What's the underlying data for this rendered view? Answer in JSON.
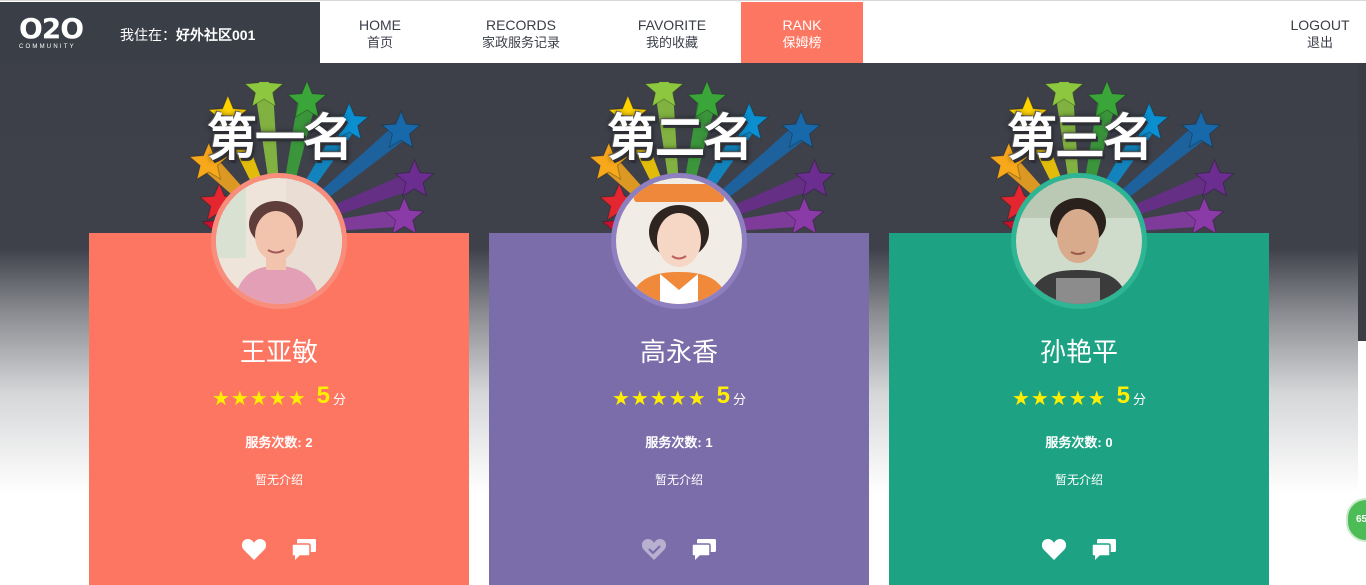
{
  "header": {
    "logo_main": "O2O",
    "logo_sub": "COMMUNITY",
    "location_label": "我住在：",
    "location_value": "好外社区001"
  },
  "nav": {
    "home": {
      "en": "HOME",
      "cn": "首页"
    },
    "records": {
      "en": "RECORDS",
      "cn": "家政服务记录"
    },
    "favorite": {
      "en": "FAVORITE",
      "cn": "我的收藏"
    },
    "rank": {
      "en": "RANK",
      "cn": "保姆榜",
      "active": true
    },
    "logout": {
      "en": "LOGOUT",
      "cn": "退出"
    }
  },
  "colors": {
    "accent": "#fd7662",
    "card1": "#fd7662",
    "card2": "#7a6da9",
    "card3": "#1da384",
    "star": "#ffee00",
    "header_dark": "#3a3e47"
  },
  "cards": [
    {
      "rank_title": "第一名",
      "name": "王亚敏",
      "stars": "★★★★★",
      "score": "5",
      "score_unit": "分",
      "service_label": "服务次数: ",
      "service_count": "2",
      "intro": "暂无介绍",
      "favorited": false
    },
    {
      "rank_title": "第二名",
      "name": "高永香",
      "stars": "★★★★★",
      "score": "5",
      "score_unit": "分",
      "service_label": "服务次数: ",
      "service_count": "1",
      "intro": "暂无介绍",
      "favorited": true
    },
    {
      "rank_title": "第三名",
      "name": "孙艳平",
      "stars": "★★★★★",
      "score": "5",
      "score_unit": "分",
      "service_label": "服务次数: ",
      "service_count": "0",
      "intro": "暂无介绍",
      "favorited": false
    }
  ],
  "floating": {
    "label": "65"
  }
}
